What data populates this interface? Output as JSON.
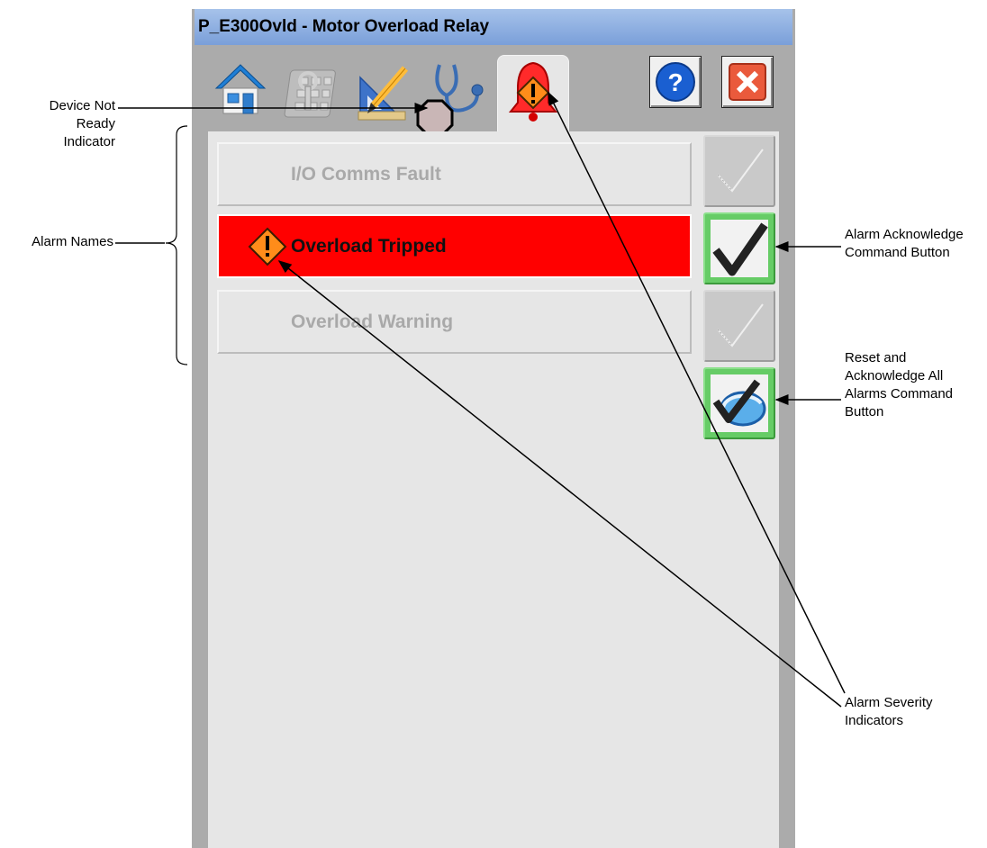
{
  "faceplate": {
    "title": "P_E300Ovld - Motor Overload Relay",
    "tabs": [
      {
        "name": "home",
        "icon": "home-icon"
      },
      {
        "name": "maintenance",
        "icon": "maintenance-icon"
      },
      {
        "name": "engineering",
        "icon": "engineering-icon"
      },
      {
        "name": "diagnostics",
        "icon": "stethoscope-icon"
      },
      {
        "name": "alarms",
        "icon": "alarm-bell-icon",
        "selected": true
      }
    ],
    "buttons": {
      "help": "help-icon",
      "close": "close-icon"
    },
    "alarms": [
      {
        "label": "I/O Comms Fault",
        "active": false,
        "ack_enabled": false
      },
      {
        "label": "Overload Tripped",
        "active": true,
        "ack_enabled": true
      },
      {
        "label": "Overload Warning",
        "active": false,
        "ack_enabled": false
      }
    ],
    "reset_ack_all_icon": "reset-acknowledge-all-icon"
  },
  "callouts": {
    "device_not_ready": "Device Not\nReady Indicator",
    "alarm_names": "Alarm Names",
    "alarm_ack": "Alarm Acknowledge\nCommand Button",
    "reset_ack_all": "Reset and\nAcknowledge All\nAlarms Command\nButton",
    "severity": "Alarm Severity\nIndicators"
  },
  "colors": {
    "alarm_active": "#ff0000",
    "panel": "#e6e6e6",
    "frame": "#ababab",
    "titlebar": "#8fb0e2",
    "ack_green": "#66cc66",
    "severity_orange": "#ff8c1a"
  }
}
